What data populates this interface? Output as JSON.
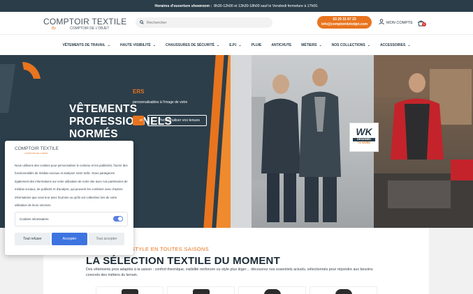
{
  "topbar": {
    "hours_label": "Horaires d'ouverture showroom :",
    "hours_text": "8h30-12h00 et 13h30-18h00 sauf le Vendredi fermeture à 17h00."
  },
  "header": {
    "logo_main": "COMPTOIR TEXTILE",
    "logo_by": "By",
    "logo_sub": "COMPTOIR DE L'OBJET",
    "search_placeholder": "Rechercher",
    "phone": "03 29 31 87 23",
    "email": "info@comptoirdelobjet.com",
    "account_label": "MON COMPTE",
    "cart_count": "0"
  },
  "nav": {
    "items": [
      {
        "label": "Vêtements de travail",
        "has_menu": true
      },
      {
        "label": "Haute visibilité",
        "has_menu": true
      },
      {
        "label": "Chaussures de sécurité",
        "has_menu": true
      },
      {
        "label": "E.P.I",
        "has_menu": true
      },
      {
        "label": "Pluie",
        "has_menu": false
      },
      {
        "label": "Antichute",
        "has_menu": false
      },
      {
        "label": "Métiers",
        "has_menu": true
      },
      {
        "label": "Nos collections",
        "has_menu": true
      },
      {
        "label": "Accessoires",
        "has_menu": true
      }
    ]
  },
  "hero": {
    "title_line1": "VÊTEMENTS",
    "title_line2": "PROFESSIONNELS",
    "title_line3": "NORMÉS",
    "subtitle": "ERS",
    "description": "personnalisables à l'image de votre",
    "btn_primary": "et",
    "btn_secondary": "→ Personnaliser vos tenues",
    "badge_main": "WK",
    "badge_line1": "DESIGNED",
    "badge_line2": "TO WORK"
  },
  "section": {
    "kicker": "U STYLE EN TOUTES SAISONS",
    "title": "LA SÉLECTION TEXTILE DU MOMENT",
    "description": "Des vêtements pros adaptés à la saison : confort thermique, visibilité renforcée ou style plus léger… découvrez nos essentiels actuels, sélectionnés pour répondre aux besoins concrets des métiers du terrain."
  },
  "cookie": {
    "logo_main": "COMPTOIR TEXTILE",
    "logo_sub": "COMPTOIR DE L'OBJET",
    "text": "Nous utilisons des cookies pour personnaliser le contenu et les publicités, fournir des fonctionnalités de médias sociaux et analyser notre trafic. Nous partageons également des informations sur votre utilisation de notre site avec nos partenaires de médias sociaux, de publicité et d'analyse, qui peuvent les combiner avec d'autres informations que vous leur avez fournies ou qu'ils ont collectées lors de votre utilisation de leurs services.",
    "consent_label": "Cookies nécessaires",
    "btn_refuse": "Tout refuser",
    "btn_accept": "Accepter",
    "btn_accept_all": "Tout accepter"
  },
  "colors": {
    "brand_dark": "#2a3d49",
    "accent_orange": "#e8741e",
    "accept_blue": "#3e74e0"
  }
}
